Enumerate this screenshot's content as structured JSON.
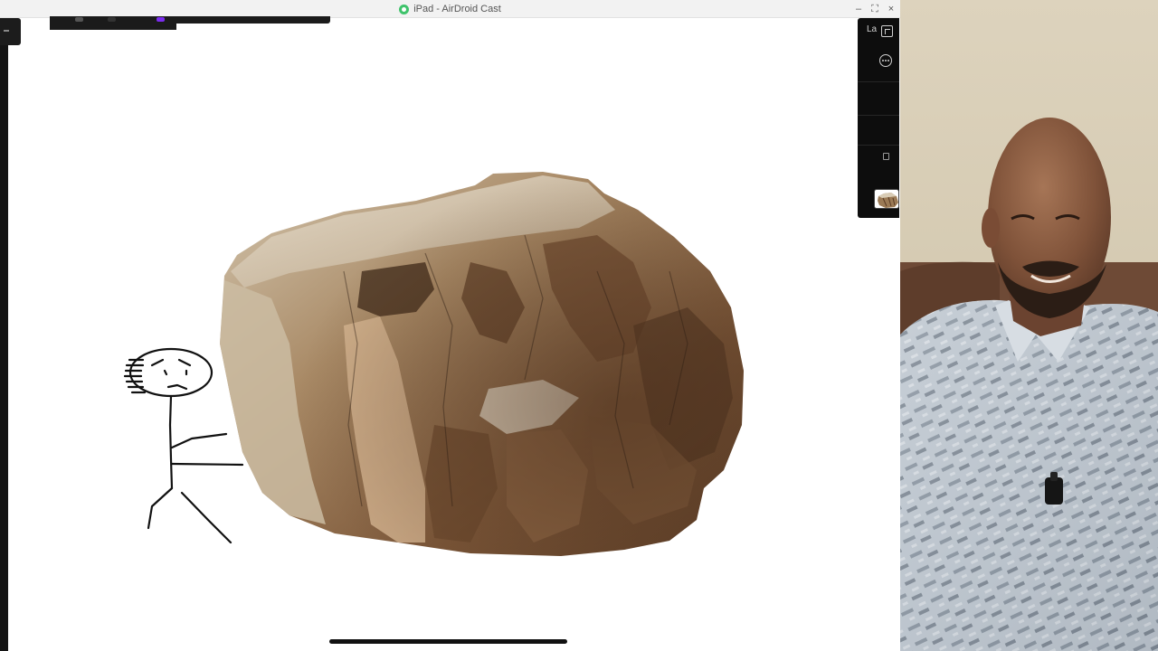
{
  "window": {
    "title": "iPad - AirDroid Cast",
    "controls": [
      "–",
      "⛶",
      "×"
    ]
  },
  "right_panel": {
    "label": "La",
    "icons": [
      "layers-icon",
      "more-options-icon",
      "lock-icon"
    ]
  },
  "canvas": {
    "drawing": [
      "stick-figure-drawing",
      "rock-image"
    ]
  },
  "colors": {
    "app_green": "#3fc36b",
    "toolbar_accent": "#7b2cf0",
    "panel_bg": "#0d0d0d"
  }
}
